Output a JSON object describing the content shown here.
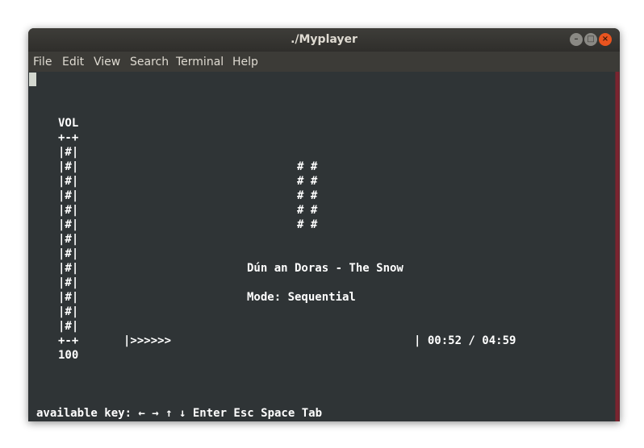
{
  "window": {
    "title": "./Myplayer"
  },
  "menu": [
    "File",
    "Edit",
    "View",
    "Search",
    "Terminal",
    "Help"
  ],
  "volume": {
    "label": "VOL",
    "top": "+-+",
    "bar_lines": [
      "|#|",
      "|#|",
      "|#|",
      "|#|",
      "|#|",
      "|#|",
      "|#|",
      "|#|",
      "|#|",
      "|#|",
      "|#|",
      "|#|",
      "|#|"
    ],
    "bottom": "+-+",
    "value": "100"
  },
  "visualizer": {
    "lines": [
      "# #",
      "# #",
      "# #",
      "# #",
      "# #"
    ]
  },
  "now_playing": {
    "track": "Dún an Doras - The Snow",
    "mode": "Mode: Sequential"
  },
  "progress": {
    "bar": "|>>>>>>",
    "time": "| 00:52 / 04:59"
  },
  "footer": {
    "keys": "available key: ← → ↑ ↓ Enter Esc Space Tab"
  },
  "colors": {
    "terminal_bg": "#2f3436",
    "titlebar_bg": "#3c3b37",
    "text": "#ffffff",
    "close_button": "#e9541f"
  }
}
